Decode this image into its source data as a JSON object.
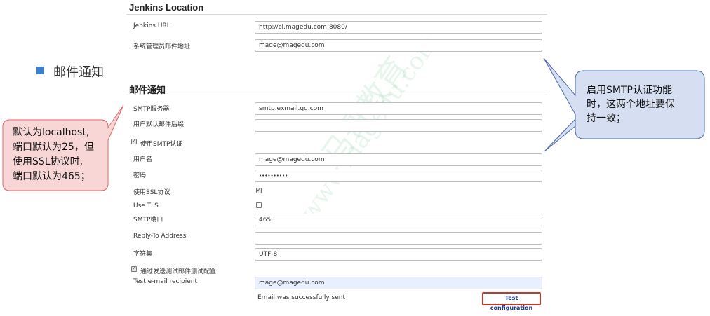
{
  "jenkins_location": {
    "title": "Jenkins Location",
    "url_label": "Jenkins URL",
    "url_value": "http://ci.magedu.com:8080/",
    "admin_email_label": "系统管理员邮件地址",
    "admin_email_value": "mage@magedu.com"
  },
  "bullet": {
    "text": "邮件通知"
  },
  "email_notification": {
    "title": "邮件通知",
    "smtp_server_label": "SMTP服务器",
    "smtp_server_value": "smtp.exmail.qq.com",
    "default_suffix_label": "用户默认邮件后缀",
    "default_suffix_value": "",
    "use_smtp_auth_label": "使用SMTP认证",
    "use_smtp_auth_checked": true,
    "username_label": "用户名",
    "username_value": "mage@magedu.com",
    "password_label": "密码",
    "password_value": "••••••••••",
    "use_ssl_label": "使用SSL协议",
    "use_ssl_checked": true,
    "use_tls_label": "Use TLS",
    "use_tls_checked": false,
    "smtp_port_label": "SMTP端口",
    "smtp_port_value": "465",
    "reply_to_label": "Reply-To Address",
    "reply_to_value": "",
    "charset_label": "字符集",
    "charset_value": "UTF-8",
    "test_mail_label": "通过发送测试邮件测试配置",
    "test_mail_checked": true,
    "test_recipient_label": "Test e-mail recipient",
    "test_recipient_value": "mage@magedu.com",
    "status_text": "Email was successfully sent",
    "test_button_label": "Test configuration"
  },
  "callouts": {
    "left_lines": [
      "默认为localhost,",
      "端口默认为25，但",
      "使用SSL协议时,",
      "端口默认为465；"
    ],
    "right_lines": [
      "启用SMTP认证功能",
      "时，这两个地址要保",
      "持一致；"
    ]
  },
  "colors": {
    "left_callout_bg": "#f8d6d6",
    "left_callout_border": "#e06666",
    "right_callout_bg": "#d6dff2",
    "right_callout_border": "#4a6aa8",
    "bullet": "#3d7fd1",
    "button_border": "#c0392b"
  }
}
